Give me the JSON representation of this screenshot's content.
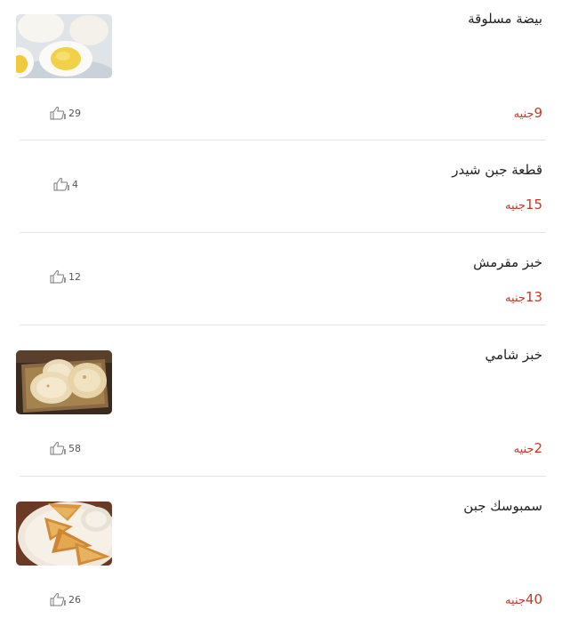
{
  "currency_label": "جنيه",
  "items": [
    {
      "name": "بيضة مسلوقة",
      "price": "9",
      "likes": "29",
      "image": "boiled-eggs-photo"
    },
    {
      "name": "قطعة جبن شيدر",
      "price": "15",
      "likes": "4",
      "image": null
    },
    {
      "name": "خبز مقرمش",
      "price": "13",
      "likes": "12",
      "image": null
    },
    {
      "name": "خبز شامي",
      "price": "2",
      "likes": "58",
      "image": "pita-bread-photo"
    },
    {
      "name": "سمبوسك جبن",
      "price": "40",
      "likes": "26",
      "image": "cheese-sambousek-photo"
    }
  ],
  "colors": {
    "price": "#c0392b",
    "divider": "#e3e3e3",
    "text": "#222222"
  }
}
